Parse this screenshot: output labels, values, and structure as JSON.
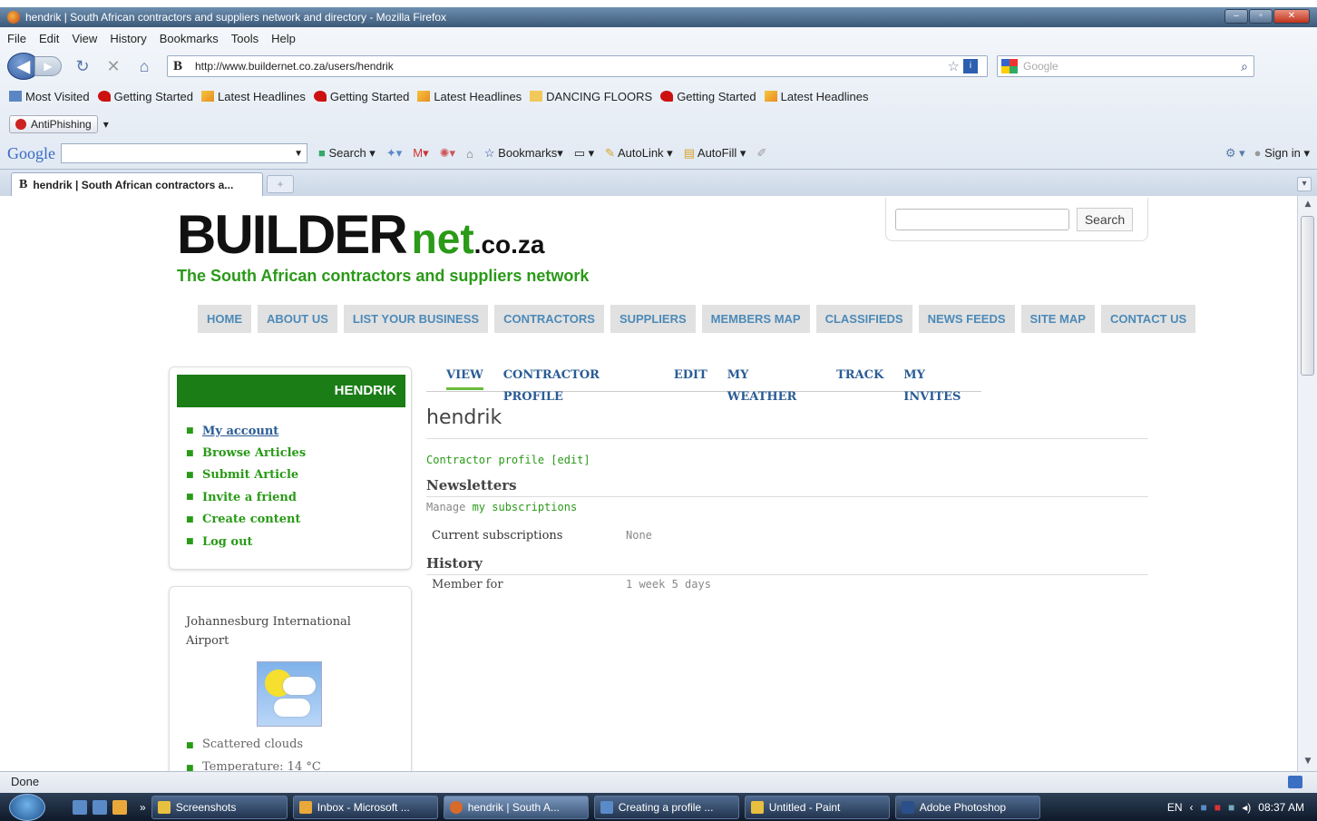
{
  "window": {
    "title": "hendrik | South African contractors and suppliers network and directory - Mozilla Firefox"
  },
  "menu": [
    "File",
    "Edit",
    "View",
    "History",
    "Bookmarks",
    "Tools",
    "Help"
  ],
  "url": "http://www.buildernet.co.za/users/hendrik",
  "search_placeholder": "Google",
  "bookmarks": [
    "Most Visited",
    "Getting Started",
    "Latest Headlines",
    "Getting Started",
    "Latest Headlines",
    "DANCING FLOORS",
    "Getting Started",
    "Latest Headlines"
  ],
  "antiphishing": "AntiPhishing",
  "google_toolbar": {
    "logo": "Google",
    "search": "Search",
    "bookmarks": "Bookmarks",
    "autolink": "AutoLink",
    "autofill": "AutoFill",
    "signin": "Sign in"
  },
  "tab": {
    "title": "hendrik | South African contractors a..."
  },
  "site": {
    "logo_builder": "BUILDER",
    "logo_net": "net",
    "logo_coza": ".co.za",
    "tagline": "The South African contractors and suppliers network",
    "search_button": "Search",
    "nav": [
      "HOME",
      "ABOUT US",
      "LIST YOUR BUSINESS",
      "CONTRACTORS",
      "SUPPLIERS",
      "MEMBERS MAP",
      "CLASSIFIEDS",
      "NEWS FEEDS",
      "SITE MAP",
      "CONTACT US"
    ],
    "user_block_title": "HENDRIK",
    "user_links": [
      "My account",
      "Browse Articles",
      "Submit Article",
      "Invite a friend",
      "Create content",
      "Log out"
    ],
    "weather": {
      "city": "Johannesburg International Airport",
      "condition": "Scattered clouds",
      "temperature": "Temperature: 14 °C"
    },
    "subtabs": [
      "VIEW",
      "CONTRACTOR PROFILE",
      "EDIT",
      "MY WEATHER",
      "TRACK",
      "MY INVITES"
    ],
    "page_title": "hendrik",
    "contractor_profile": "Contractor profile [edit]",
    "newsletters_heading": "Newsletters",
    "manage_prefix": "Manage ",
    "manage_link": "my subscriptions",
    "current_subscriptions_label": "Current subscriptions",
    "current_subscriptions_value": "None",
    "history_heading": "History",
    "member_for_label": "Member for",
    "member_for_value": "1 week 5 days"
  },
  "status": "Done",
  "taskbar": {
    "items": [
      "Screenshots",
      "Inbox - Microsoft ...",
      "hendrik | South A...",
      "Creating a profile ...",
      "Untitled - Paint",
      "Adobe Photoshop"
    ],
    "lang": "EN",
    "time": "08:37 AM"
  }
}
